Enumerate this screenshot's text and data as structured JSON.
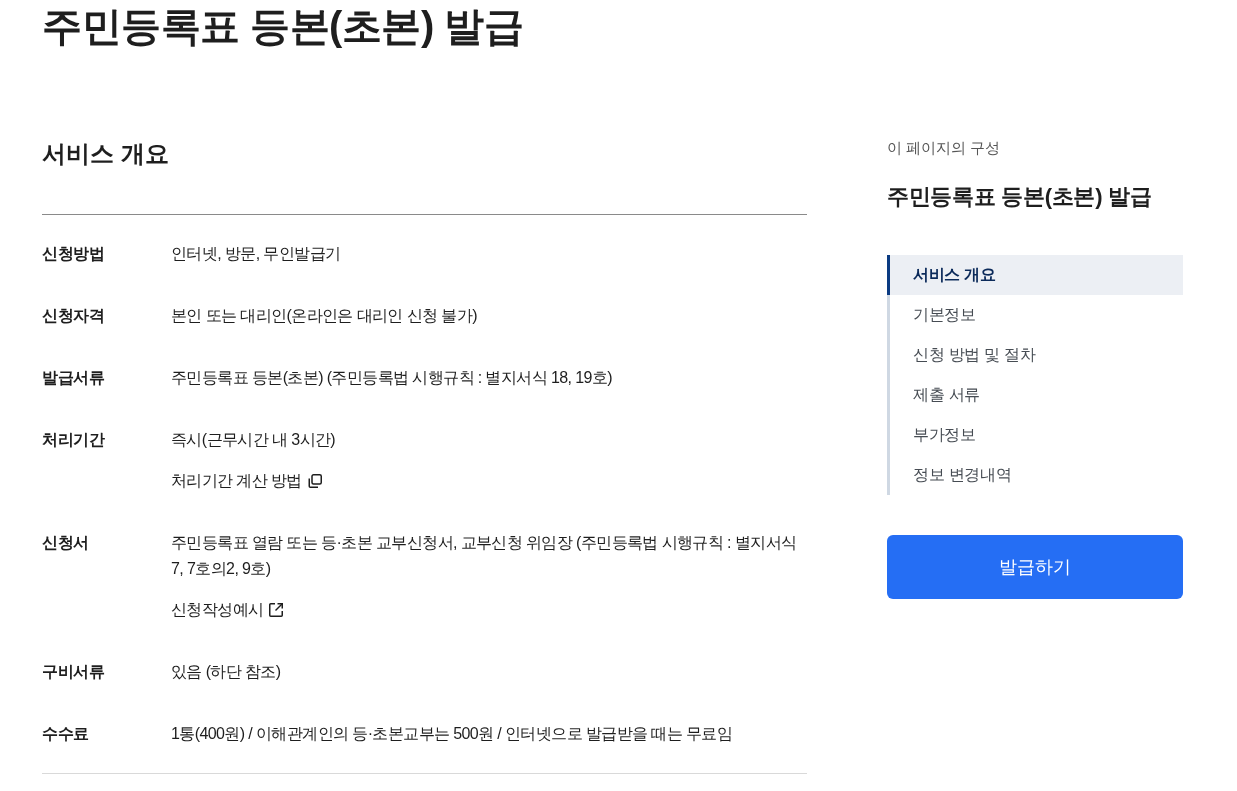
{
  "page_title": "주민등록표 등본(초본) 발급",
  "section": {
    "title": "서비스 개요",
    "rows": [
      {
        "label": "신청방법",
        "lines": [
          {
            "kind": "text",
            "text": "인터넷, 방문, 무인발급기"
          }
        ]
      },
      {
        "label": "신청자격",
        "lines": [
          {
            "kind": "text",
            "text": "본인 또는 대리인(온라인은 대리인 신청 불가)"
          }
        ]
      },
      {
        "label": "발급서류",
        "lines": [
          {
            "kind": "text",
            "text": "주민등록표 등본(초본) (주민등록법 시행규칙 : 별지서식 18, 19호)"
          }
        ]
      },
      {
        "label": "처리기간",
        "lines": [
          {
            "kind": "text",
            "text": "즉시(근무시간 내 3시간)"
          },
          {
            "kind": "popup_link",
            "text": "처리기간 계산 방법"
          }
        ]
      },
      {
        "label": "신청서",
        "lines": [
          {
            "kind": "text",
            "text": "주민등록표 열람 또는 등·초본 교부신청서, 교부신청 위임장 (주민등록법 시행규칙 : 별지서식 7, 7호의2, 9호)"
          },
          {
            "kind": "external_link",
            "text": "신청작성예시"
          }
        ]
      },
      {
        "label": "구비서류",
        "lines": [
          {
            "kind": "text",
            "text": "있음 (하단 참조)"
          }
        ]
      },
      {
        "label": "수수료",
        "lines": [
          {
            "kind": "text",
            "text": "1통(400원) / 이해관계인의 등·초본교부는 500원 / 인터넷으로 발급받을 때는 무료임"
          }
        ]
      }
    ]
  },
  "toc": {
    "caption": "이 페이지의 구성",
    "title": "주민등록표 등본(초본) 발급",
    "items": [
      {
        "label": "서비스 개요",
        "selected": true
      },
      {
        "label": "기본정보",
        "selected": false
      },
      {
        "label": "신청 방법 및 절차",
        "selected": false
      },
      {
        "label": "제출 서류",
        "selected": false
      },
      {
        "label": "부가정보",
        "selected": false
      },
      {
        "label": "정보 변경내역",
        "selected": false
      }
    ]
  },
  "issue_button": "발급하기"
}
